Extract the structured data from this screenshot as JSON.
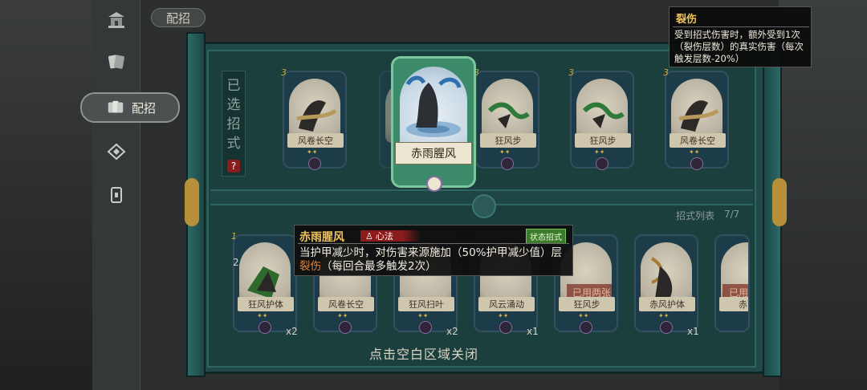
{
  "header": {
    "title": "配招"
  },
  "sidebar": {
    "items": [
      {
        "icon": "temple-icon"
      },
      {
        "icon": "cards-icon"
      },
      {
        "icon": "card-hand-icon",
        "label": "配招",
        "active": true
      },
      {
        "icon": "crest-icon"
      },
      {
        "icon": "card-single-icon"
      }
    ]
  },
  "selected_panel": {
    "label_chars": [
      "已",
      "选",
      "招",
      "式"
    ],
    "help": "?",
    "cards": [
      {
        "name": "风卷长空",
        "cost": "3"
      },
      {
        "name": "狂风步",
        "cost": "3"
      },
      {
        "name": "狂风步",
        "cost": "3"
      },
      {
        "name": "风卷长空",
        "cost": "3"
      }
    ]
  },
  "hero_card": {
    "name": "赤雨腥风"
  },
  "list": {
    "label": "招式列表",
    "count": "7/7",
    "cards": [
      {
        "name": "狂风护体",
        "cost": "1",
        "badge": "2",
        "qty": "x2"
      },
      {
        "name": "风卷长空",
        "qty": ""
      },
      {
        "name": "狂风扫叶",
        "qty": "x2"
      },
      {
        "name": "风云涌动",
        "qty": "x1"
      },
      {
        "name": "狂风步",
        "tag": "已用两张",
        "qty": ""
      },
      {
        "name": "赤风护体",
        "qty": "x1"
      },
      {
        "name": "赤雨",
        "tag": "已用"
      }
    ]
  },
  "tooltip": {
    "name": "赤雨腥风",
    "type": "心法",
    "badge": "状态招式",
    "desc_a": "当护甲减少时，对伤害来源施加（50%护甲减少值）层",
    "desc_highlight": "裂伤",
    "desc_b": "（每回合最多触发2次）"
  },
  "info": {
    "title": "裂伤",
    "desc": "受到招式伤害时，额外受到1次（裂伤层数）的真实伤害（每次触发层数-20%）"
  },
  "close_hint": "点击空白区域关闭"
}
